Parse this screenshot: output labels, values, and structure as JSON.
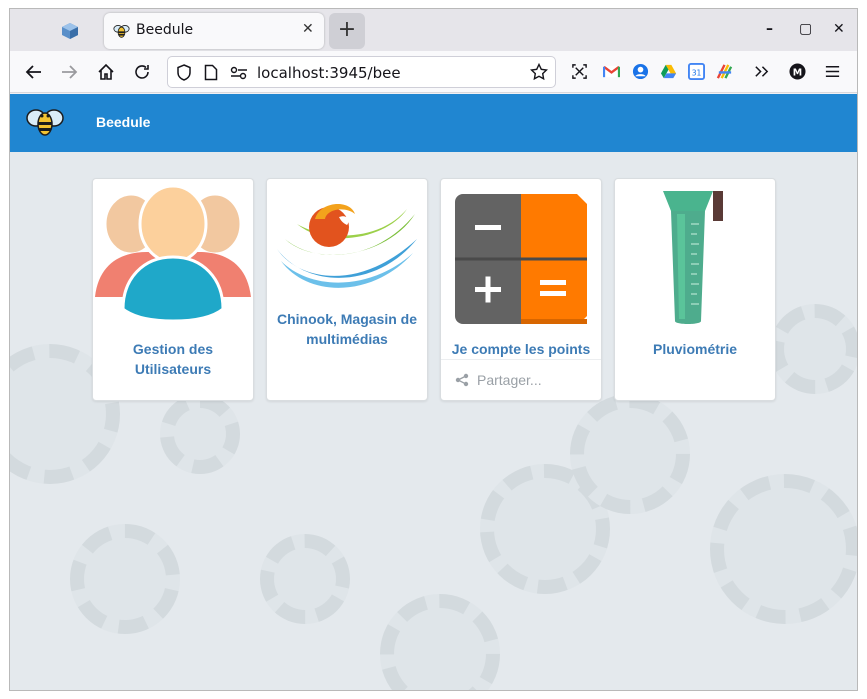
{
  "browser": {
    "tab_title": "Beedule",
    "url": "localhost:3945/bee",
    "new_tab_label": "+",
    "close_tab_label": "✕",
    "window_controls": [
      "–",
      "▢",
      "✕"
    ]
  },
  "app": {
    "title": "Beedule",
    "accent_color": "#2086d1"
  },
  "cards": [
    {
      "title": "Gestion des Utilisateurs",
      "icon": "users-icon"
    },
    {
      "title": "Chinook, Magasin de multimédias",
      "icon": "chinook-logo"
    },
    {
      "title": "Je compte les points",
      "icon": "calculator-icon",
      "share_label": "Partager..."
    },
    {
      "title": "Pluviométrie",
      "icon": "rain-gauge-icon"
    }
  ]
}
